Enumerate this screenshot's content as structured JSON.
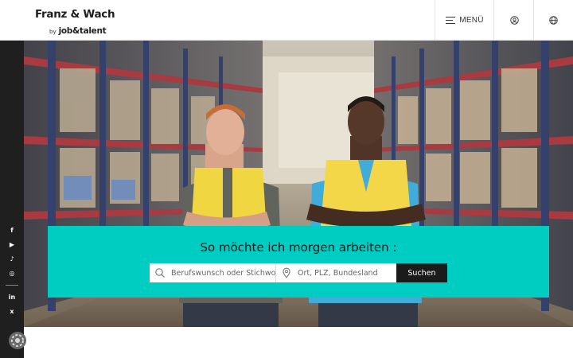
{
  "header": {
    "logo_main": "Franz & Wach",
    "logo_by": "by",
    "logo_brand": "job&talent",
    "menu_label": "MENÜ",
    "account_icon": "user-icon",
    "language_icon": "globe-icon"
  },
  "social": {
    "items": [
      {
        "name": "facebook",
        "glyph": "f"
      },
      {
        "name": "youtube",
        "glyph": "▶"
      },
      {
        "name": "tiktok",
        "glyph": "♪"
      },
      {
        "name": "instagram",
        "glyph": "◎"
      },
      {
        "name": "linkedin",
        "glyph": "in"
      },
      {
        "name": "xing",
        "glyph": "x"
      }
    ]
  },
  "search": {
    "title": "So möchte ich morgen arbeiten :",
    "job_placeholder": "Berufswunsch oder Stichwort",
    "location_placeholder": "Ort, PLZ, Bundesland",
    "button_label": "Suchen"
  },
  "colors": {
    "accent": "#00cdc2",
    "dark": "#1b1b1b",
    "sidebar": "#1f1f1f"
  }
}
